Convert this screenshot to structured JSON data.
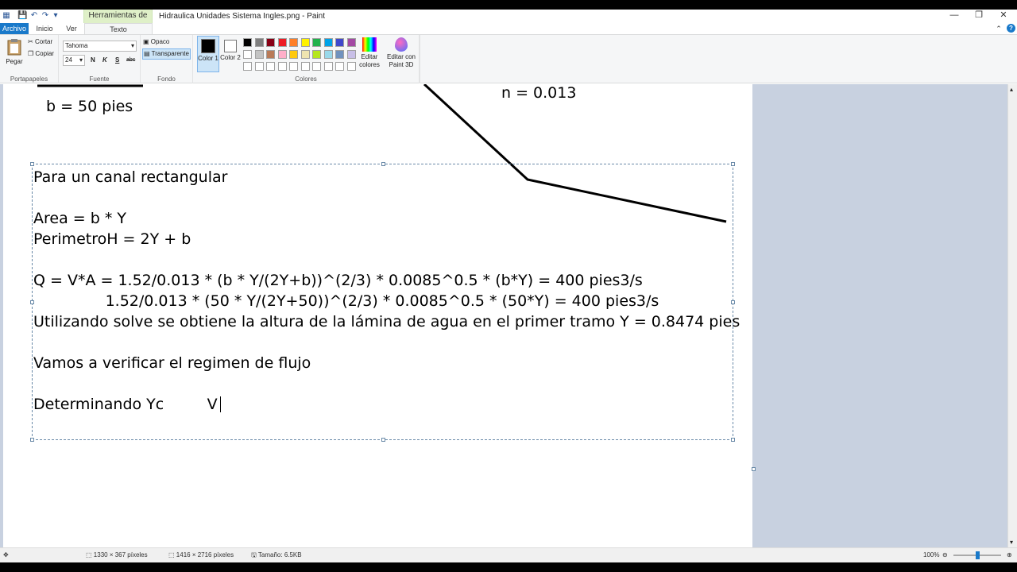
{
  "window": {
    "title": "Hidraulica Unidades Sistema Ingles.png - Paint",
    "context_tab": "Herramientas de texto",
    "controls": {
      "minimize": "—",
      "restore": "❐",
      "close": "✕"
    }
  },
  "tabs": {
    "archivo": "Archivo",
    "inicio": "Inicio",
    "ver": "Ver",
    "texto": "Texto"
  },
  "ribbon": {
    "clipboard": {
      "label": "Portapapeles",
      "paste": "Pegar",
      "cut": "Cortar",
      "copy": "Copiar"
    },
    "font": {
      "label": "Fuente",
      "name": "Tahoma",
      "size": "24",
      "bold": "N",
      "italic": "K",
      "underline": "S",
      "strike": "abc"
    },
    "background": {
      "label": "Fondo",
      "opaque": "Opaco",
      "transparent": "Transparente"
    },
    "colors": {
      "label": "Colores",
      "color1": "Color 1",
      "color2": "Color 2",
      "color1_value": "#000000",
      "color2_value": "#ffffff",
      "edit": "Editar colores",
      "paint3d": "Editar con Paint 3D",
      "palette_row1": [
        "#000000",
        "#7f7f7f",
        "#880015",
        "#ed1c24",
        "#ff7f27",
        "#fff200",
        "#22b14c",
        "#00a2e8",
        "#3f48cc",
        "#a349a4"
      ],
      "palette_row2": [
        "#ffffff",
        "#c3c3c3",
        "#b97a57",
        "#ffaec9",
        "#ffc90e",
        "#efe4b0",
        "#b5e61d",
        "#99d9ea",
        "#7092be",
        "#c8bfe7"
      ],
      "palette_row3": [
        "#ffffff",
        "#ffffff",
        "#ffffff",
        "#ffffff",
        "#ffffff",
        "#ffffff",
        "#ffffff",
        "#ffffff",
        "#ffffff",
        "#ffffff"
      ]
    }
  },
  "canvas": {
    "b_label": "b = 50 pies",
    "n_label": "n = 0.013",
    "textbox_lines": [
      "Para un canal rectangular",
      "",
      "Area = b * Y",
      "PerimetroH = 2Y + b",
      "",
      "Q = V*A = 1.52/0.013 * (b * Y/(2Y+b))^(2/3) * 0.0085^0.5 * (b*Y) = 400 pies3/s",
      "               1.52/0.013 * (50 * Y/(2Y+50))^(2/3) * 0.0085^0.5 * (50*Y) = 400 pies3/s",
      "Utilizando solve se obtiene la altura de la lámina de agua en el primer tramo Y = 0.8474 pies",
      "",
      "Vamos a verificar el regimen de flujo",
      "",
      "Determinando Yc         V"
    ]
  },
  "status": {
    "cursor_pos": "1330 × 367 píxeles",
    "image_size": "1416 × 2716 píxeles",
    "file_size": "Tamaño: 6.5KB",
    "zoom": "100%"
  }
}
